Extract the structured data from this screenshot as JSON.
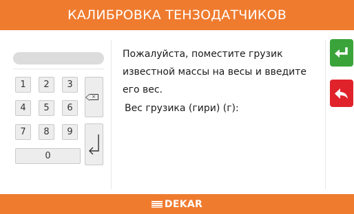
{
  "header": {
    "title": "КАЛИБРОВКА ТЕНЗОДАТЧИКОВ"
  },
  "keypad": {
    "display_value": "",
    "keys": {
      "k1": "1",
      "k2": "2",
      "k3": "3",
      "k4": "4",
      "k5": "5",
      "k6": "6",
      "k7": "7",
      "k8": "8",
      "k9": "9",
      "k0": "0"
    },
    "backspace_glyph": "×",
    "backspace_icon": "backspace-icon",
    "enter_icon": "enter-icon"
  },
  "content": {
    "instruction": "Пожалуйста, поместите грузик известной массы на весы и введите его вес.",
    "weight_label": "Вес грузика (гири) (г):"
  },
  "side_buttons": {
    "confirm": {
      "icon": "enter-arrow-icon",
      "color": "#3aa43a"
    },
    "back": {
      "icon": "undo-arrow-icon",
      "color": "#e0232b"
    }
  },
  "footer": {
    "brand": "DEKAR"
  },
  "colors": {
    "accent": "#ef7b2f"
  }
}
